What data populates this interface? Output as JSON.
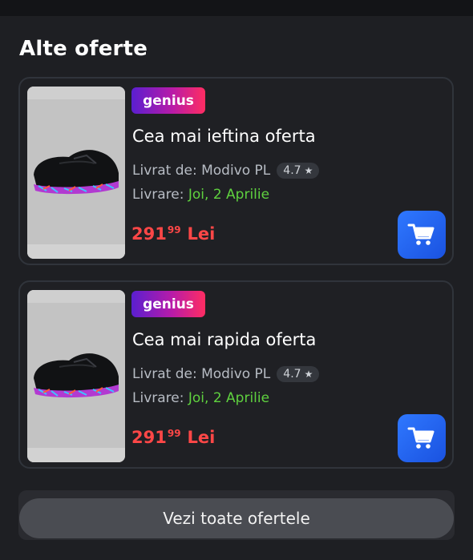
{
  "section": {
    "title": "Alte oferte"
  },
  "offers": [
    {
      "badge": "genius",
      "title": "Cea mai ieftina oferta",
      "seller_label": "Livrat de: Modivo PL",
      "rating": "4.7",
      "delivery_label": "Livrare: ",
      "delivery_date": "Joi, 2 Aprilie",
      "price_int": "291",
      "price_dec": "99",
      "currency": "Lei"
    },
    {
      "badge": "genius",
      "title": "Cea mai rapida oferta",
      "seller_label": "Livrat de: Modivo PL",
      "rating": "4.7",
      "delivery_label": "Livrare: ",
      "delivery_date": "Joi, 2 Aprilie",
      "price_int": "291",
      "price_dec": "99",
      "currency": "Lei"
    }
  ],
  "footer": {
    "all_offers_label": "Vezi toate ofertele"
  },
  "colors": {
    "price": "#ff4747",
    "delivery_date": "#5fd13f",
    "cart_button": "#2f78ff"
  },
  "icons": {
    "cart": "cart-icon",
    "star": "star-icon"
  }
}
